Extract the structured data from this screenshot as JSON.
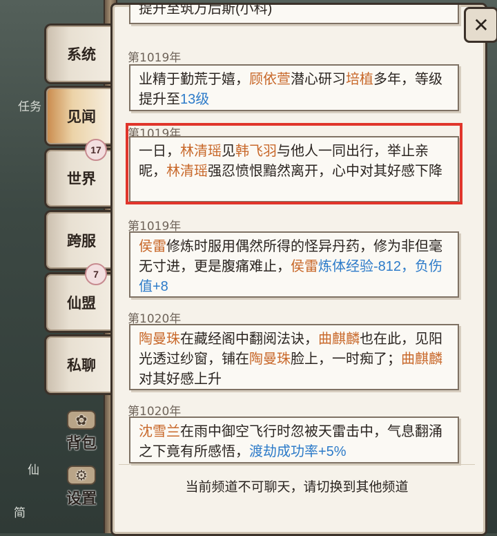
{
  "background": {
    "label_top": "任务",
    "label_mid": "仙",
    "label_bottom": "简"
  },
  "tabs": [
    {
      "label": "系统",
      "badge": null
    },
    {
      "label": "见闻",
      "badge": null,
      "active": true
    },
    {
      "label": "世界",
      "badge": "17"
    },
    {
      "label": "跨服",
      "badge": null
    },
    {
      "label": "仙盟",
      "badge": "7"
    },
    {
      "label": "私聊",
      "badge": null
    }
  ],
  "side_buttons": [
    {
      "label": "背包",
      "icon": "bag-icon"
    },
    {
      "label": "设置",
      "icon": "gear-icon"
    }
  ],
  "close_label": "✕",
  "top_partial_text": "提升至筑万后斯(小科)",
  "entries": [
    {
      "year": "第1019年",
      "parts": [
        [
          "业精于勤荒于嬉，",
          ""
        ],
        [
          "顾依萱",
          "orange"
        ],
        [
          "潜心研习",
          ""
        ],
        [
          "培植",
          "orange"
        ],
        [
          "多年，等级提升至",
          ""
        ],
        [
          "13级",
          "blue"
        ]
      ]
    },
    {
      "year": "第1019年",
      "parts": [
        [
          "一日，",
          ""
        ],
        [
          "林清瑶",
          "orange"
        ],
        [
          "见",
          ""
        ],
        [
          "韩飞羽",
          "orange"
        ],
        [
          "与他人一同出行，举止亲昵，",
          ""
        ],
        [
          "林清瑶",
          "orange"
        ],
        [
          "强忍愤恨黯然离开，心中对其好感下降",
          ""
        ]
      ]
    },
    {
      "year": "第1019年",
      "parts": [
        [
          "侯雷",
          "orange"
        ],
        [
          "修炼时服用偶然所得的怪异丹药，修为非但毫无寸进，更是腹痛难止，",
          ""
        ],
        [
          "侯雷",
          "orange"
        ],
        [
          "炼体经验-812，负伤值+8",
          "blue"
        ]
      ]
    },
    {
      "year": "第1020年",
      "parts": [
        [
          "陶曼珠",
          "orange"
        ],
        [
          "在藏经阁中翻阅法诀，",
          ""
        ],
        [
          "曲麒麟",
          "orange"
        ],
        [
          "也在此，见阳光透过纱窗，铺在",
          ""
        ],
        [
          "陶曼珠",
          "orange"
        ],
        [
          "脸上，一时痴了；",
          ""
        ],
        [
          "曲麒麟",
          "orange"
        ],
        [
          "对其好感上升",
          ""
        ]
      ]
    },
    {
      "year": "第1020年",
      "parts": [
        [
          "沈雪兰",
          "orange"
        ],
        [
          "在雨中御空飞行时忽被天雷击中，气息翻涌之下竟有所感悟，",
          ""
        ],
        [
          "渡劫成功率+5%",
          "blue"
        ]
      ]
    }
  ],
  "footer": "当前频道不可聊天，请切换到其他频道",
  "colors": {
    "accent_orange": "#c8682a",
    "accent_blue": "#2d7bc9",
    "highlight": "#e0352b"
  }
}
